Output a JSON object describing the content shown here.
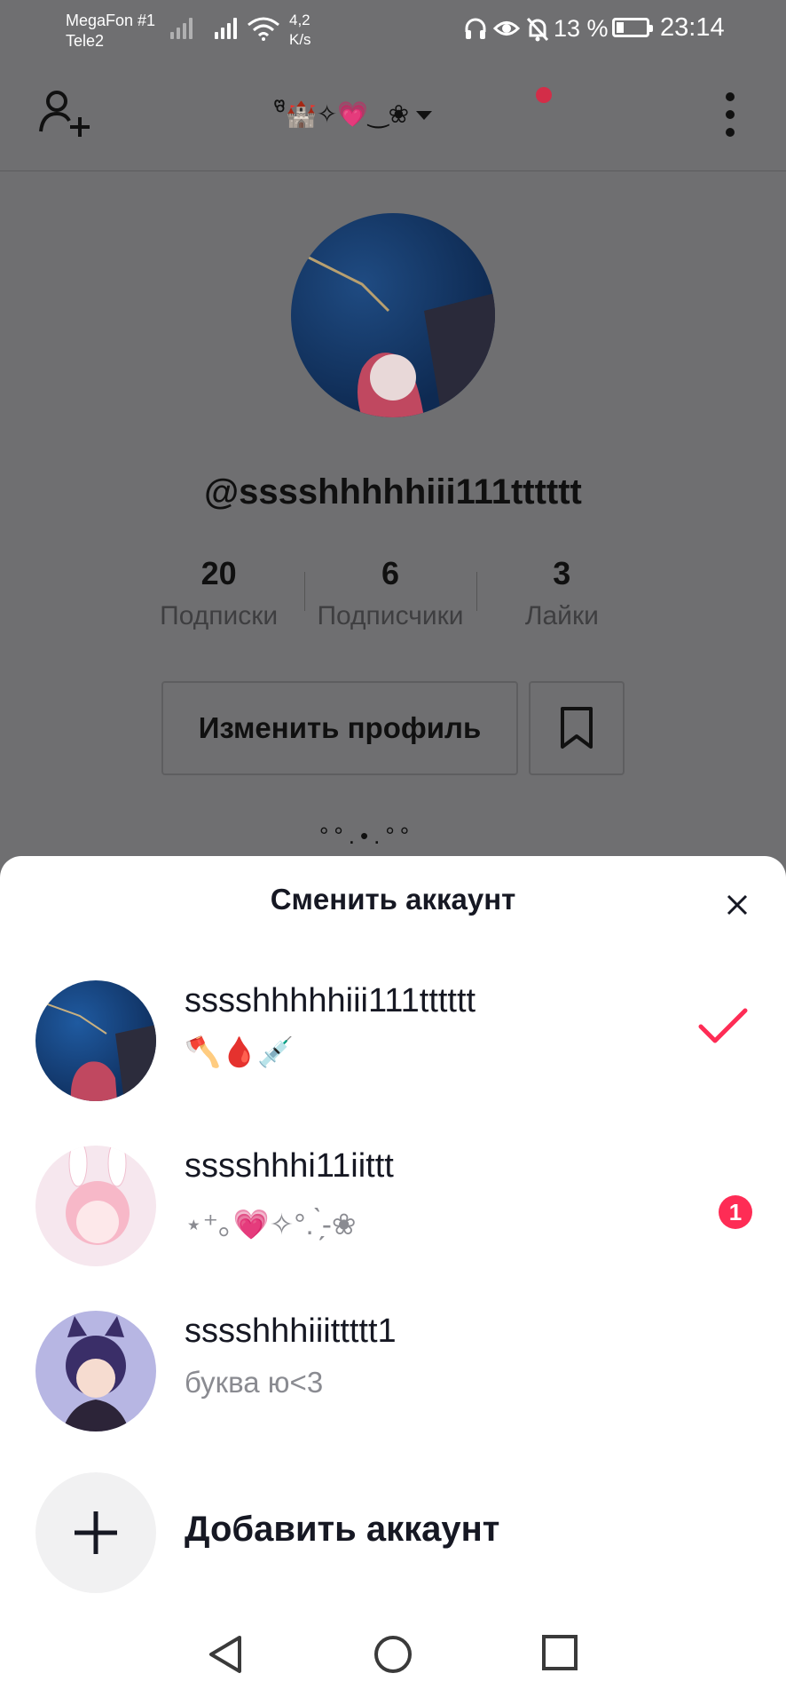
{
  "status_bar": {
    "carrier_1": "MegaFon #1",
    "carrier_2": "Tele2",
    "speed_value": "4,2",
    "speed_unit": "K/s",
    "battery": "13 %",
    "time": "23:14"
  },
  "profile": {
    "nickname_decoration": "°ᩚ🏰✧💗‿❀",
    "username": "@sssshhhhhiii111tttttt",
    "stats": [
      {
        "value": "20",
        "label": "Подписки"
      },
      {
        "value": "6",
        "label": "Подписчики"
      },
      {
        "value": "3",
        "label": "Лайки"
      }
    ],
    "edit_button": "Изменить профиль",
    "bio_deco": "°°.•.°°"
  },
  "sheet": {
    "title": "Сменить аккаунт",
    "accounts": [
      {
        "name": "sssshhhhhiii111tttttt",
        "subtitle": "🪓🩸💉",
        "selected": true
      },
      {
        "name": "sssshhhi11iittt",
        "subtitle": "⋆⁺｡💗✧°. ̗̀-❀",
        "badge": "1"
      },
      {
        "name": "sssshhhiiittttt1",
        "subtitle": "буква ю<3"
      }
    ],
    "add_account": "Добавить аккаунт"
  },
  "colors": {
    "accent": "#fe2c55",
    "overlay": "#6f6f71"
  }
}
